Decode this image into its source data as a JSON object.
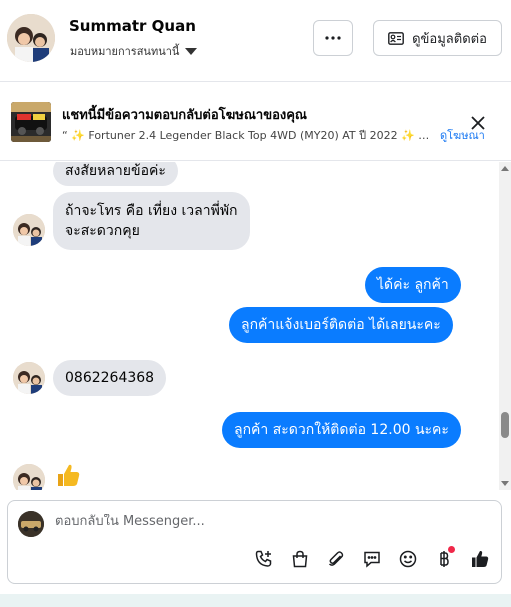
{
  "header": {
    "contact_name": "Summatr Quan",
    "assign_label": "มอบหมายการสนทนานี้",
    "more_label": "···",
    "info_button_label": "ดูข้อมูลติดต่อ"
  },
  "ad_banner": {
    "title": "แชทนี้มีข้อความตอบกลับต่อโฆษณาของคุณ",
    "subtitle": "“ ✨ Fortuner 2.4 Legender Black Top 4WD (MY20) AT ปี 2022 ✨ …",
    "link_label": "ดูโฆษณา"
  },
  "messages": [
    {
      "dir": "in",
      "text": "สงสัยหลายข้อค่ะ"
    },
    {
      "dir": "in",
      "text_line1": "ถ้าจะโทร คือ เที่ยง เวลาพี่พัก",
      "text_line2": "จะสะดวกคุย"
    },
    {
      "dir": "out",
      "text": "ได้ค่ะ  ลูกค้า"
    },
    {
      "dir": "out",
      "text": "ลูกค้าแจ้งเบอร์ติดต่อ ได้เลยนะคะ"
    },
    {
      "dir": "in",
      "text": "0862264368"
    },
    {
      "dir": "out",
      "text": "ลูกค้า สะดวกให้ติดต่อ 12.00 นะคะ"
    },
    {
      "dir": "in",
      "text": "👍"
    }
  ],
  "composer": {
    "placeholder": "ตอบกลับใน Messenger..."
  },
  "icons": {
    "tools": [
      "phone-plus-icon",
      "shopping-bag-icon",
      "paperclip-icon",
      "saved-reply-icon",
      "emoji-icon",
      "baht-icon",
      "thumbs-up-icon"
    ]
  },
  "colors": {
    "outgoing_bubble": "#0a7cff",
    "incoming_bubble": "#e4e6eb",
    "link": "#1877f2",
    "notification_dot": "#f02849"
  }
}
